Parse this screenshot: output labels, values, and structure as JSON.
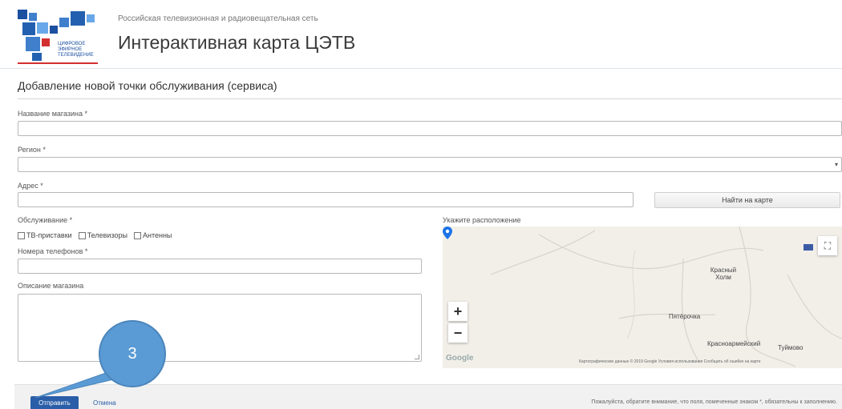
{
  "header": {
    "org_name": "Российская телевизионная и радиовещательная сеть",
    "app_title": "Интерактивная карта ЦЭТВ",
    "logo_text": [
      "ЦИФРОВОЕ",
      "ЭФИРНОЕ",
      "ТЕЛЕВИДЕНИЕ"
    ]
  },
  "form": {
    "title": "Добавление новой точки обслуживания (сервиса)",
    "store_name_label": "Название магазина *",
    "store_name_value": "",
    "region_label": "Регион *",
    "region_value": "",
    "address_label": "Адрес *",
    "address_value": "",
    "find_on_map_label": "Найти на карте",
    "service_label": "Обслуживание *",
    "service_options": [
      "ТВ-приставки",
      "Телевизоры",
      "Антенны"
    ],
    "phones_label": "Номера телефонов *",
    "phones_value": "",
    "description_label": "Описание магазина",
    "description_value": "",
    "location_label": "Укажите расположение"
  },
  "map": {
    "zoom_in": "+",
    "zoom_out": "−",
    "fullscreen": "⛶",
    "places": [
      "Красный Холм",
      "Пятёрочка",
      "Красноармейский",
      "Туймово"
    ],
    "attribution": "Картографические данные © 2019 Google   Условия использования   Сообщить об ошибке на карте",
    "provider": "Google"
  },
  "footer": {
    "submit_label": "Отправить",
    "cancel_label": "Отмена",
    "note": "Пожалуйста, обратите внимание, что поля, помеченные знаком *, обязательны к заполнению."
  },
  "annotation": {
    "number": "3",
    "color": "#5b9bd5"
  },
  "colors": {
    "primary": "#2a5ea8",
    "pin": "#1a73e8"
  }
}
